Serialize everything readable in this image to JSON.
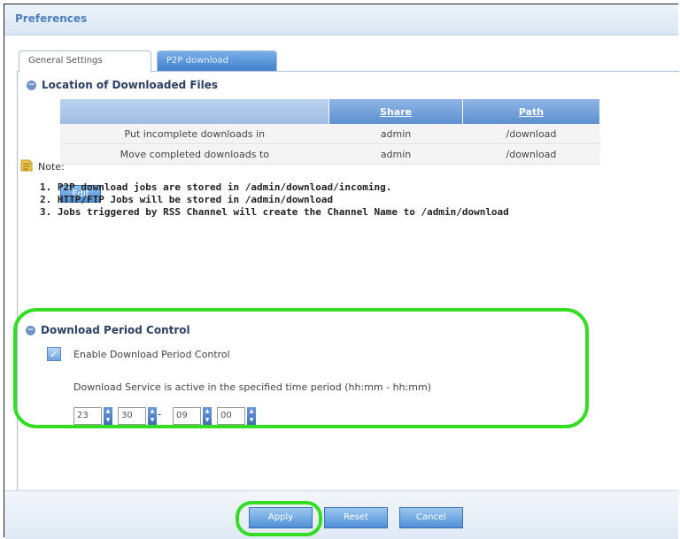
{
  "window": {
    "title": "Preferences"
  },
  "tabs": [
    {
      "label": "General Settings",
      "active": true
    },
    {
      "label": "P2P download",
      "active": false
    }
  ],
  "location_section": {
    "title": "Location of Downloaded Files",
    "columns": [
      "",
      "Share",
      "Path"
    ],
    "rows": [
      {
        "label": "Put incomplete downloads in",
        "share": "admin",
        "path": "/download"
      },
      {
        "label": "Move completed downloads to",
        "share": "admin",
        "path": "/download"
      }
    ],
    "edit_label": "Edit"
  },
  "note": {
    "label": "Note:",
    "lines": [
      "1. P2P download jobs are stored in /admin/download/incoming.",
      "2. HTTP/FTP Jobs will be stored in /admin/download",
      "3. Jobs triggered by RSS Channel will create the Channel Name to /admin/download"
    ]
  },
  "period_section": {
    "title": "Download Period Control",
    "enable_label": "Enable Download Period Control",
    "enable_checked": true,
    "description": "Download Service is active in the specified time period (hh:mm - hh:mm)",
    "start_hour": "23",
    "start_minute": "30",
    "separator": "-",
    "end_hour": "09",
    "end_minute": "00"
  },
  "buttons": {
    "apply": "Apply",
    "reset": "Reset",
    "cancel": "Cancel"
  },
  "colors": {
    "highlight": "#33dd22",
    "accent": "#4f8fd8",
    "title": "#4d7fbb"
  }
}
